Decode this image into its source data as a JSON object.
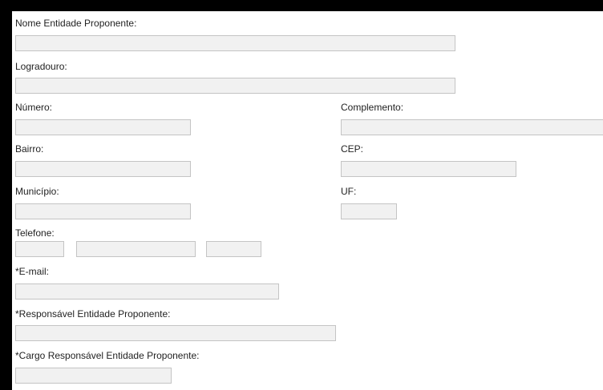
{
  "form": {
    "nome_entidade": {
      "label": "Nome Entidade Proponente:",
      "value": ""
    },
    "logradouro": {
      "label": "Logradouro:",
      "value": ""
    },
    "numero": {
      "label": "Número:",
      "value": ""
    },
    "complemento": {
      "label": "Complemento:",
      "value": ""
    },
    "bairro": {
      "label": "Bairro:",
      "value": ""
    },
    "cep": {
      "label": "CEP:",
      "value": ""
    },
    "municipio": {
      "label": "Município:",
      "value": ""
    },
    "uf": {
      "label": "UF:",
      "value": ""
    },
    "telefone": {
      "label": "Telefone:",
      "ddd": "",
      "numero": "",
      "ramal": ""
    },
    "email": {
      "label": "*E-mail:",
      "value": ""
    },
    "responsavel": {
      "label": "*Responsável Entidade Proponente:",
      "value": ""
    },
    "cargo_responsavel": {
      "label": "*Cargo Responsável Entidade Proponente:",
      "value": ""
    }
  },
  "colors": {
    "frame": "#000000",
    "field_bg": "#f1f1f1",
    "field_border": "#c4c4c4",
    "text": "#222222"
  }
}
